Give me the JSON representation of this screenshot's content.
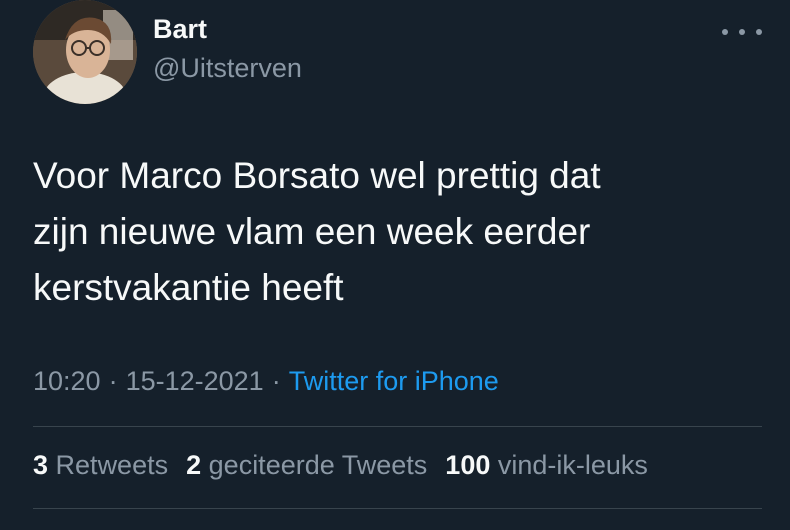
{
  "tweet": {
    "author": {
      "display_name": "Bart",
      "handle": "@Uitsterven"
    },
    "text_lines": [
      "Voor Marco Borsato wel prettig dat",
      "zijn nieuwe vlam een week eerder",
      "kerstvakantie heeft"
    ],
    "time": "10:20",
    "separator": "·",
    "date": "15-12-2021",
    "source": "Twitter for iPhone",
    "stats": {
      "retweets_count": "3",
      "retweets_label": "Retweets",
      "quotes_count": "2",
      "quotes_label": "geciteerde Tweets",
      "likes_count": "100",
      "likes_label": "vind-ik-leuks"
    }
  },
  "icons": {
    "more": "more-options-icon"
  },
  "colors": {
    "background": "#15202b",
    "primary_text": "#f7f9f9",
    "secondary_text": "#8b98a5",
    "link": "#1d9bf0",
    "divider": "#38444d"
  }
}
